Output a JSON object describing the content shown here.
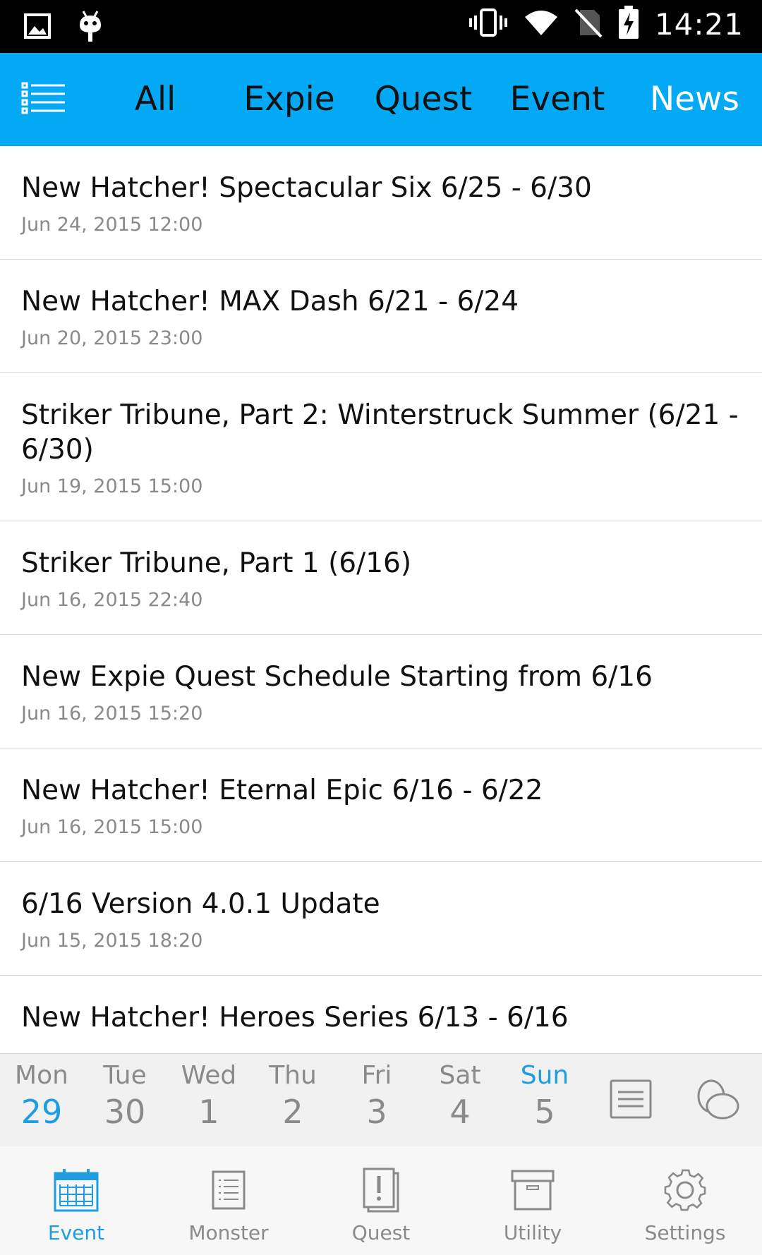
{
  "status_bar": {
    "time": "14:21",
    "icons": [
      "image-icon",
      "android-debug-icon",
      "vibrate-icon",
      "wifi-icon",
      "no-sim-icon",
      "battery-charging-icon"
    ]
  },
  "top_tabs": {
    "menu_icon": "list-menu-icon",
    "tabs": [
      {
        "label": "All",
        "active": false
      },
      {
        "label": "Expie",
        "active": false
      },
      {
        "label": "Quest",
        "active": false
      },
      {
        "label": "Event",
        "active": false
      },
      {
        "label": "News",
        "active": true
      }
    ]
  },
  "news": [
    {
      "title": "New Hatcher! Spectacular Six 6/25 - 6/30",
      "date": "Jun 24, 2015 12:00"
    },
    {
      "title": "New Hatcher! MAX Dash 6/21 - 6/24",
      "date": "Jun 20, 2015 23:00"
    },
    {
      "title": "Striker Tribune, Part 2: Winterstruck Summer (6/21 - 6/30)",
      "date": "Jun 19, 2015 15:00"
    },
    {
      "title": "Striker Tribune, Part 1 (6/16)",
      "date": "Jun 16, 2015 22:40"
    },
    {
      "title": "New Expie Quest Schedule Starting from 6/16",
      "date": "Jun 16, 2015 15:20"
    },
    {
      "title": "New Hatcher! Eternal Epic 6/16 - 6/22",
      "date": "Jun 16, 2015 15:00"
    },
    {
      "title": "6/16 Version 4.0.1 Update",
      "date": "Jun 15, 2015 18:20"
    },
    {
      "title": "New Hatcher! Heroes Series 6/13 - 6/16",
      "date": ""
    }
  ],
  "calendar": {
    "days": [
      {
        "name": "Mon",
        "num": "29",
        "today": true,
        "weekend": false
      },
      {
        "name": "Tue",
        "num": "30",
        "today": false,
        "weekend": false
      },
      {
        "name": "Wed",
        "num": "1",
        "today": false,
        "weekend": false
      },
      {
        "name": "Thu",
        "num": "2",
        "today": false,
        "weekend": false
      },
      {
        "name": "Fri",
        "num": "3",
        "today": false,
        "weekend": false
      },
      {
        "name": "Sat",
        "num": "4",
        "today": false,
        "weekend": false
      },
      {
        "name": "Sun",
        "num": "5",
        "today": false,
        "weekend": true
      }
    ],
    "icons": [
      "list-view-icon",
      "eggs-icon"
    ]
  },
  "bottom_nav": [
    {
      "label": "Event",
      "icon": "calendar-icon",
      "active": true
    },
    {
      "label": "Monster",
      "icon": "monster-list-icon",
      "active": false
    },
    {
      "label": "Quest",
      "icon": "quest-icon",
      "active": false
    },
    {
      "label": "Utility",
      "icon": "box-icon",
      "active": false
    },
    {
      "label": "Settings",
      "icon": "gear-icon",
      "active": false
    }
  ],
  "colors": {
    "accent": "#03a9f4",
    "highlight": "#1e9de0",
    "text": "#111111",
    "muted": "#8a8a8a"
  }
}
